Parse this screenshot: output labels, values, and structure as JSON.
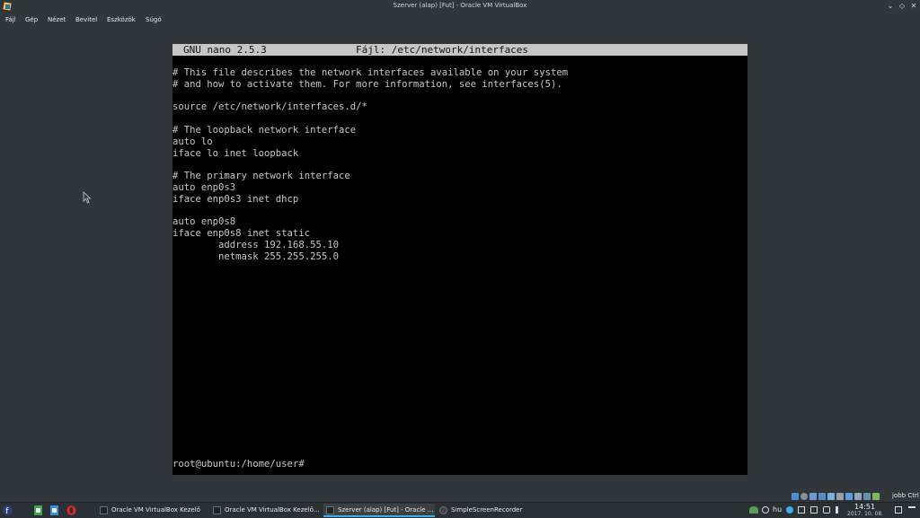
{
  "window": {
    "title": "Szerver (alap) [Fut] - Oracle VM VirtualBox",
    "controls": [
      "minimize-icon",
      "restore-icon",
      "close-icon"
    ]
  },
  "menubar": {
    "items": [
      "Fájl",
      "Gép",
      "Nézet",
      "Bevitel",
      "Eszközök",
      "Súgó"
    ]
  },
  "nano": {
    "version": "GNU nano 2.5.3",
    "file_label": "Fájl: /etc/network/interfaces",
    "content": "# This file describes the network interfaces available on your system\n# and how to activate them. For more information, see interfaces(5).\n\nsource /etc/network/interfaces.d/*\n\n# The loopback network interface\nauto lo\niface lo inet loopback\n\n# The primary network interface\nauto enp0s3\niface enp0s3 inet dhcp\n\nauto enp0s8\niface enp0s8 inet static\n        address 192.168.55.10\n        netmask 255.255.255.0",
    "prompt": "root@ubuntu:/home/user#"
  },
  "statusbar": {
    "host_key": "jobb Ctrl"
  },
  "taskbar": {
    "tasks": [
      {
        "label": "Oracle VM VirtualBox Kezelő",
        "active": false
      },
      {
        "label": "Oracle VM VirtualBox Kezelő...",
        "active": false
      },
      {
        "label": "Szerver (alap) [Fut] - Oracle ...",
        "active": true
      },
      {
        "label": "SimpleScreenRecorder",
        "active": false
      }
    ],
    "keyboard_layout": "hu",
    "clock_time": "14:51",
    "clock_date": "2017. 10. 08."
  },
  "colors": {
    "desktop_bg": "#31363b",
    "taskbar_bg": "#2b3035",
    "accent": "#3daee9",
    "nano_bar": "#c6c6c6",
    "terminal_text": "#c7c7c7"
  }
}
